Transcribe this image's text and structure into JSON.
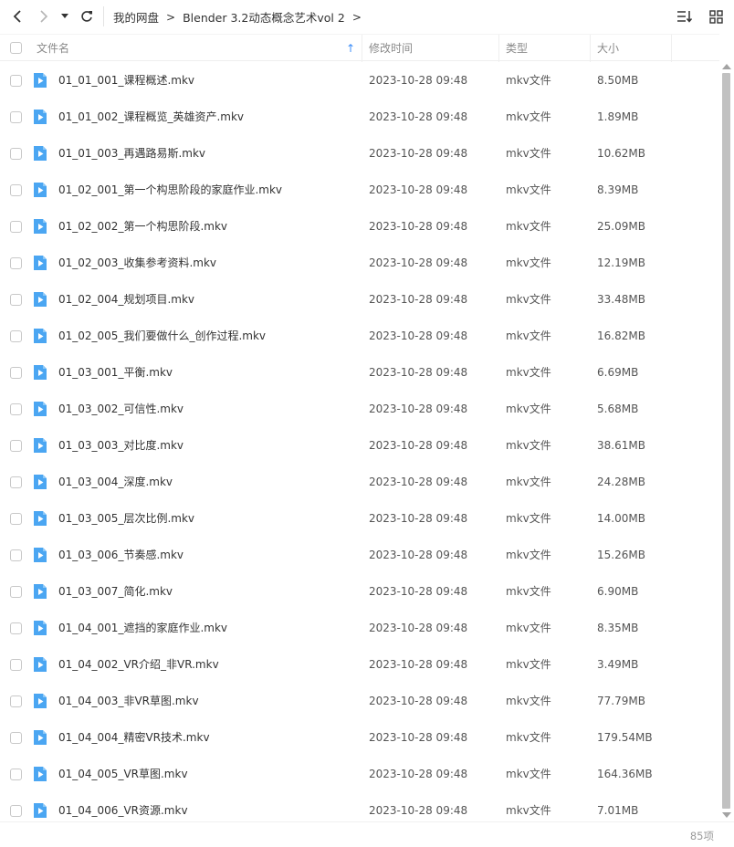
{
  "toolbar": {
    "back_icon": "chevron-left-icon",
    "forward_icon": "chevron-right-icon",
    "dropdown_icon": "caret-down-icon",
    "refresh_icon": "refresh-icon",
    "sort_icon": "sort-list-icon",
    "grid_icon": "grid-view-icon"
  },
  "breadcrumb": {
    "root": "我的网盘",
    "folder": "Blender 3.2动态概念艺术vol 2"
  },
  "header": {
    "name": "文件名",
    "modified": "修改时间",
    "type": "类型",
    "size": "大小",
    "sort_indicator": "↑"
  },
  "colors": {
    "accent": "#3d8ef8",
    "file_icon": "#4ba6f2"
  },
  "files": [
    {
      "name": "01_01_001_课程概述.mkv",
      "date": "2023-10-28 09:48",
      "type": "mkv文件",
      "size": "8.50MB"
    },
    {
      "name": "01_01_002_课程概览_英雄资产.mkv",
      "date": "2023-10-28 09:48",
      "type": "mkv文件",
      "size": "1.89MB"
    },
    {
      "name": "01_01_003_再遇路易斯.mkv",
      "date": "2023-10-28 09:48",
      "type": "mkv文件",
      "size": "10.62MB"
    },
    {
      "name": "01_02_001_第一个构思阶段的家庭作业.mkv",
      "date": "2023-10-28 09:48",
      "type": "mkv文件",
      "size": "8.39MB"
    },
    {
      "name": "01_02_002_第一个构思阶段.mkv",
      "date": "2023-10-28 09:48",
      "type": "mkv文件",
      "size": "25.09MB"
    },
    {
      "name": "01_02_003_收集参考资料.mkv",
      "date": "2023-10-28 09:48",
      "type": "mkv文件",
      "size": "12.19MB"
    },
    {
      "name": "01_02_004_规划项目.mkv",
      "date": "2023-10-28 09:48",
      "type": "mkv文件",
      "size": "33.48MB"
    },
    {
      "name": "01_02_005_我们要做什么_创作过程.mkv",
      "date": "2023-10-28 09:48",
      "type": "mkv文件",
      "size": "16.82MB"
    },
    {
      "name": "01_03_001_平衡.mkv",
      "date": "2023-10-28 09:48",
      "type": "mkv文件",
      "size": "6.69MB"
    },
    {
      "name": "01_03_002_可信性.mkv",
      "date": "2023-10-28 09:48",
      "type": "mkv文件",
      "size": "5.68MB"
    },
    {
      "name": "01_03_003_对比度.mkv",
      "date": "2023-10-28 09:48",
      "type": "mkv文件",
      "size": "38.61MB"
    },
    {
      "name": "01_03_004_深度.mkv",
      "date": "2023-10-28 09:48",
      "type": "mkv文件",
      "size": "24.28MB"
    },
    {
      "name": "01_03_005_层次比例.mkv",
      "date": "2023-10-28 09:48",
      "type": "mkv文件",
      "size": "14.00MB"
    },
    {
      "name": "01_03_006_节奏感.mkv",
      "date": "2023-10-28 09:48",
      "type": "mkv文件",
      "size": "15.26MB"
    },
    {
      "name": "01_03_007_简化.mkv",
      "date": "2023-10-28 09:48",
      "type": "mkv文件",
      "size": "6.90MB"
    },
    {
      "name": "01_04_001_遮挡的家庭作业.mkv",
      "date": "2023-10-28 09:48",
      "type": "mkv文件",
      "size": "8.35MB"
    },
    {
      "name": "01_04_002_VR介绍_非VR.mkv",
      "date": "2023-10-28 09:48",
      "type": "mkv文件",
      "size": "3.49MB"
    },
    {
      "name": "01_04_003_非VR草图.mkv",
      "date": "2023-10-28 09:48",
      "type": "mkv文件",
      "size": "77.79MB"
    },
    {
      "name": "01_04_004_精密VR技术.mkv",
      "date": "2023-10-28 09:48",
      "type": "mkv文件",
      "size": "179.54MB"
    },
    {
      "name": "01_04_005_VR草图.mkv",
      "date": "2023-10-28 09:48",
      "type": "mkv文件",
      "size": "164.36MB"
    },
    {
      "name": "01_04_006_VR资源.mkv",
      "date": "2023-10-28 09:48",
      "type": "mkv文件",
      "size": "7.01MB"
    }
  ],
  "footer": {
    "count": "85项"
  }
}
